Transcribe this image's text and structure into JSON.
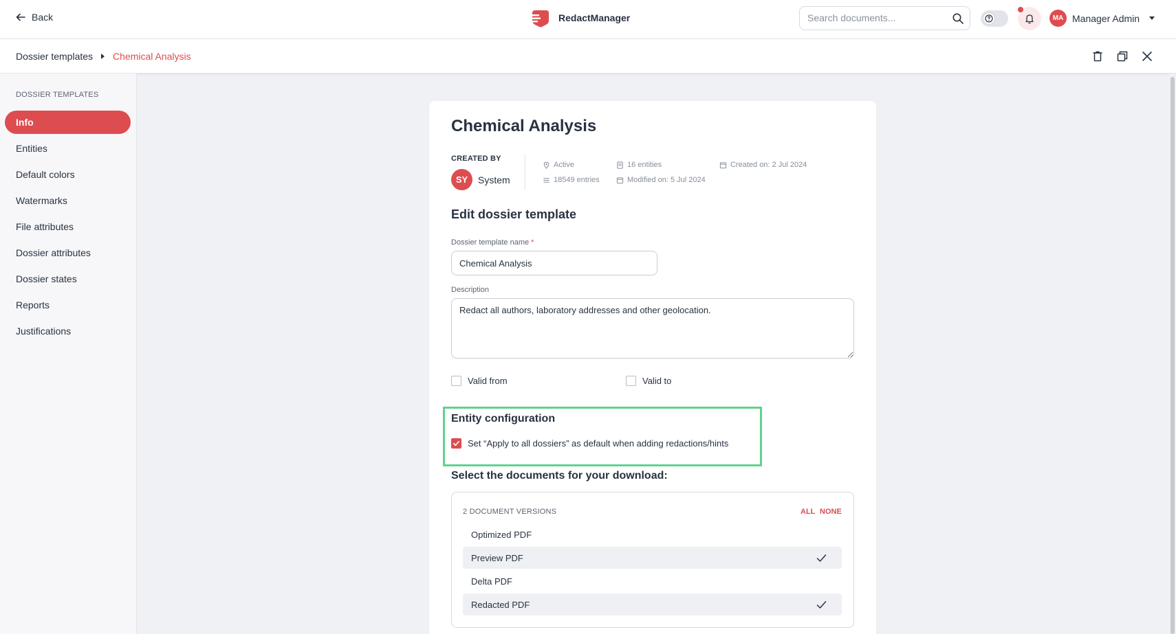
{
  "header": {
    "back_label": "Back",
    "brand_name": "RedactManager",
    "search_placeholder": "Search documents...",
    "user_initials": "MA",
    "user_name": "Manager Admin",
    "accent_color": "#dd4d50"
  },
  "breadcrumb": {
    "items": [
      "Dossier templates",
      "Chemical Analysis"
    ]
  },
  "toolbar": {
    "icons": [
      "delete-icon",
      "duplicate-icon",
      "close-icon"
    ]
  },
  "sidebar": {
    "heading": "DOSSIER TEMPLATES",
    "items": [
      {
        "label": "Info",
        "active": true
      },
      {
        "label": "Entities"
      },
      {
        "label": "Default colors"
      },
      {
        "label": "Watermarks"
      },
      {
        "label": "File attributes"
      },
      {
        "label": "Dossier attributes"
      },
      {
        "label": "Dossier states"
      },
      {
        "label": "Reports"
      },
      {
        "label": "Justifications"
      }
    ]
  },
  "template": {
    "title": "Chemical Analysis",
    "created_by_label": "CREATED BY",
    "creator_initials": "SY",
    "creator_name": "System",
    "status": "Active",
    "entries": "18549 entries",
    "entities": "16 entities",
    "modified": "Modified on: 5 Jul 2024",
    "created": "Created on: 2 Jul 2024"
  },
  "form": {
    "section_title": "Edit dossier template",
    "name_label": "Dossier template name",
    "name_required": "*",
    "name_value": "Chemical Analysis",
    "description_label": "Description",
    "description_value": "Redact all authors, laboratory addresses and other geolocation.",
    "valid_from_label": "Valid from",
    "valid_to_label": "Valid to",
    "valid_from_checked": false,
    "valid_to_checked": false
  },
  "entity_config": {
    "title": "Entity configuration",
    "apply_all_label": "Set “Apply to all dossiers” as default when adding redactions/hints",
    "apply_all_checked": true
  },
  "downloads": {
    "title": "Select the documents for your download:",
    "count_label": "2 DOCUMENT VERSIONS",
    "all_label": "ALL",
    "none_label": "NONE",
    "items": [
      {
        "label": "Optimized PDF",
        "selected": false
      },
      {
        "label": "Preview PDF",
        "selected": true
      },
      {
        "label": "Delta PDF",
        "selected": false
      },
      {
        "label": "Redacted PDF",
        "selected": true
      }
    ]
  }
}
